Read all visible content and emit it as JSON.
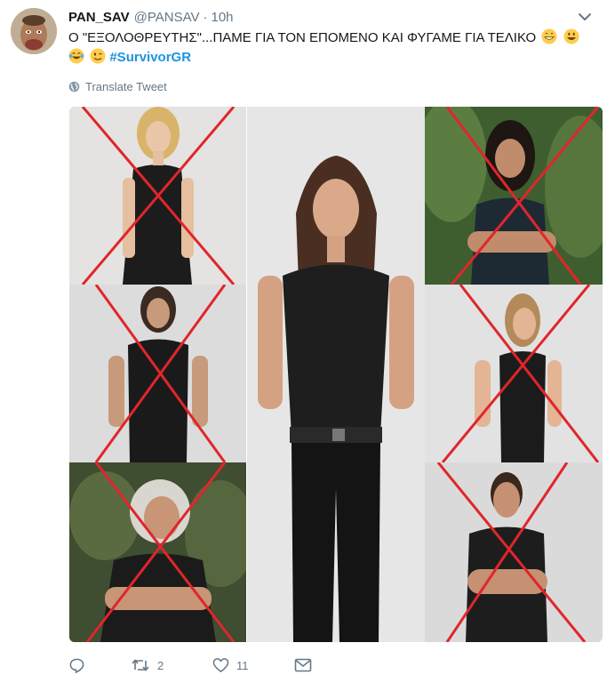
{
  "tweet": {
    "name": "PAN_SAV",
    "handle": "@PANSAV",
    "separator": "·",
    "time": "10h",
    "text_line1": "Ο \"ΕΞΟΛΟΘΡΕΥΤΗΣ\"...ΠΑΜΕ ΓΙΑ ΤΟΝ ΕΠΟΜΕΝΟ ΚΑΙ ΦΥΓΑΜΕ ΓΙΑ ΤΕΛΙΚΟ",
    "hashtag": "#SurvivorGR",
    "translate": "Translate Tweet"
  },
  "actions": {
    "reply_count": "",
    "retweet_count": "2",
    "like_count": "11"
  },
  "colors": {
    "accent": "#1b95e0",
    "muted": "#657786",
    "cross": "#e0262b"
  },
  "icons": [
    "chevron-down-icon",
    "grinning-emoji-icon",
    "smiley-emoji-icon",
    "tears-of-joy-emoji-icon",
    "winking-emoji-icon",
    "globe-icon",
    "reply-icon",
    "retweet-icon",
    "like-icon",
    "message-icon"
  ]
}
